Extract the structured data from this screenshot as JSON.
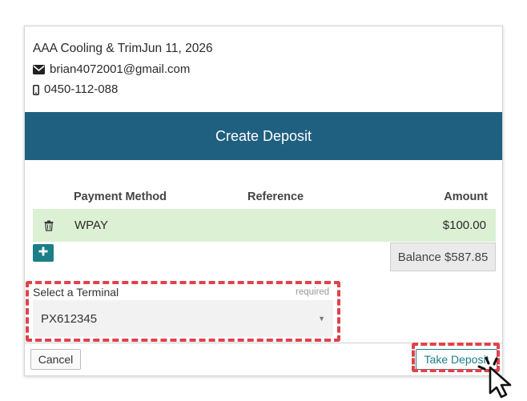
{
  "company": {
    "title": "AAA Cooling & TrimJun 11, 2026",
    "email": "brian4072001@gmail.com",
    "phone": "0450-112-088"
  },
  "dialog": {
    "title": "Create Deposit"
  },
  "table": {
    "columns": [
      "Payment Method",
      "Reference",
      "Amount"
    ],
    "rows": [
      {
        "method": "WPAY",
        "reference": "",
        "amount": "$100.00"
      }
    ]
  },
  "balance": "Balance $587.85",
  "terminal": {
    "label": "Select a Terminal",
    "required": "required",
    "selected": "PX612345"
  },
  "footer": {
    "cancel": "Cancel",
    "take_deposit": "Take Deposit"
  },
  "icons": {
    "email": "envelope-icon",
    "phone": "mobile-phone-icon",
    "delete": "trash-icon",
    "add": "plus-icon",
    "select": "caret-down-icon",
    "pointer": "click-cursor-icon"
  },
  "colors": {
    "header_band": "#1f5f80",
    "accent": "#1a7f86",
    "row_highlight": "#dcf0d3",
    "annotation": "#e0424a"
  }
}
